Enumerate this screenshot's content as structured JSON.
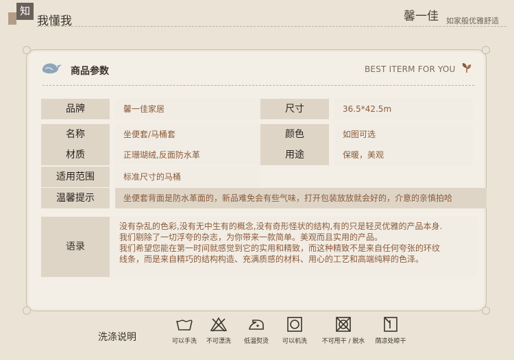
{
  "header": {
    "badge": "知",
    "title": "我懂我",
    "brand": "馨一佳",
    "slogan": "如家般优雅舒适"
  },
  "card": {
    "title": "商品参数",
    "best": "BEST ITERM FOR YOU"
  },
  "params": {
    "brand_label": "品牌",
    "brand_value": "馨一佳家居",
    "size_label": "尺寸",
    "size_value": "36.5*42.5m",
    "name_label": "名称",
    "name_value": "坐便套/马桶套",
    "color_label": "颜色",
    "color_value": "如图可选",
    "material_label": "材质",
    "material_value": "正珊瑚绒,反面防水革",
    "use_label": "用途",
    "use_value": "保暖，美观",
    "scope_label": "适用范围",
    "scope_value": "标准尺寸的马桶",
    "tip_label": "温馨提示",
    "tip_value": "坐便套背面是防水革面的，新品难免会有些气味，打开包装放放就会好的，介意的亲慎拍哈"
  },
  "quote": {
    "label": "语录",
    "line1": "没有杂乱的色彩,没有无中生有的概念,没有奇形怪状的结构,有的只是轻灵优雅的产品本身.",
    "line2": "我们剔除了一切浮夸的杂志，为你带来一款简单。美观而且实用的产品。",
    "line3": "我们希望您能在第一时间就感觉到它的实用和精致，而这种精致不是来自任何夸张的环纹",
    "line4": "线条，而是来自精巧的结构构造、充满质感的材料、用心的工艺和高端纯粹的色泽。"
  },
  "washing": {
    "title": "洗涤说明",
    "items": [
      {
        "icon": "hand-wash-icon",
        "label": "可以手洗"
      },
      {
        "icon": "no-bleach-icon",
        "label": "不可漂洗"
      },
      {
        "icon": "low-iron-icon",
        "label": "低温熨烫"
      },
      {
        "icon": "machine-wash-icon",
        "label": "可以机洗"
      },
      {
        "icon": "no-tumble-dry-icon",
        "label": "不可甩干 / 脱水"
      },
      {
        "icon": "shade-dry-icon",
        "label": "荫凉处晾干"
      }
    ]
  },
  "colors": {
    "background": "#ebe4d6",
    "label_cell": "#ded5c7",
    "value_text": "#8a5a3a",
    "bird": "#8fa5ba"
  }
}
